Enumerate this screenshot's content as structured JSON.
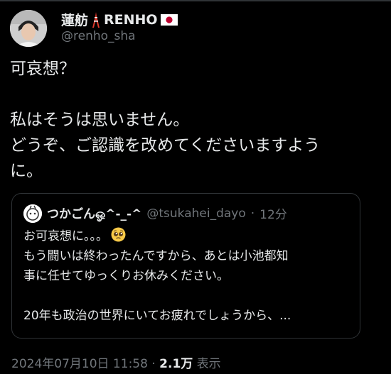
{
  "author": {
    "display_name_part1": "蓮舫",
    "display_name_part2": "RENHO",
    "handle": "@renho_sha"
  },
  "tweet": {
    "line1": "可哀想？",
    "line2": "私はそうは思いません。",
    "line3": "どうぞ、ご認識を改めてくださいますよう",
    "line4": "に。"
  },
  "quote": {
    "name": "つかごんஓ^-_-^",
    "handle": "@tsukahei_dayo",
    "separator": "·",
    "time": "12分",
    "line1": "お可哀想に。。。",
    "line2": "もう闘いは終わったんですから、あとは小池都知",
    "line3": "事に任せてゆっくりお休みください。",
    "line4": "20年も政治の世界にいてお疲れでしょうから、..."
  },
  "meta": {
    "date": "2024年07月10日 11:58",
    "separator": "·",
    "views_count": "2.1万",
    "views_label": "表示"
  },
  "icons": [
    "tokyo-tower-icon",
    "japan-flag-icon",
    "pleading-face-icon"
  ]
}
